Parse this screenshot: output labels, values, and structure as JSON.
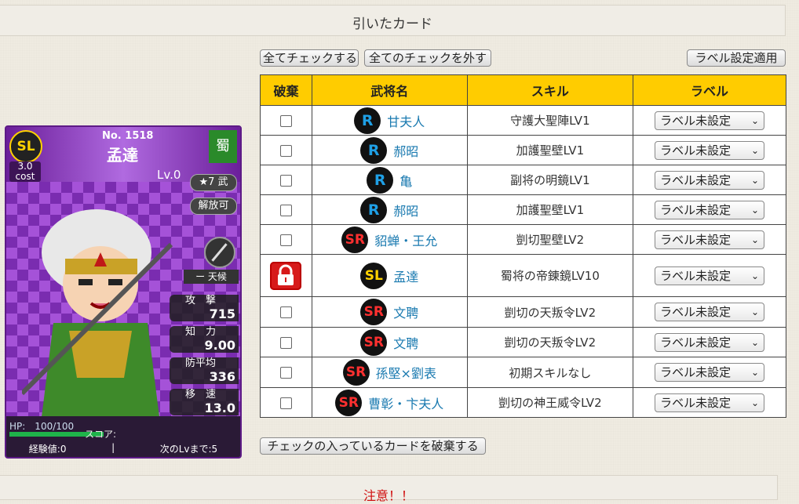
{
  "header": {
    "title": "引いたカード"
  },
  "toolbar": {
    "check_all": "全てチェックする",
    "uncheck_all": "全てのチェックを外す",
    "apply_label": "ラベル設定適用"
  },
  "table": {
    "headers": [
      "破棄",
      "武将名",
      "スキル",
      "ラベル"
    ],
    "rows": [
      {
        "rarity": "R",
        "name": "甘夫人",
        "skill": "守護大聖陣LV1",
        "label": "ラベル未設定",
        "locked": false
      },
      {
        "rarity": "R",
        "name": "郝昭",
        "skill": "加護聖壁LV1",
        "label": "ラベル未設定",
        "locked": false
      },
      {
        "rarity": "R",
        "name": "亀",
        "skill": "副将の明鏡LV1",
        "label": "ラベル未設定",
        "locked": false
      },
      {
        "rarity": "R",
        "name": "郝昭",
        "skill": "加護聖壁LV1",
        "label": "ラベル未設定",
        "locked": false
      },
      {
        "rarity": "SR",
        "name": "貂蝉・王允",
        "skill": "剴切聖壁LV2",
        "label": "ラベル未設定",
        "locked": false
      },
      {
        "rarity": "SL",
        "name": "孟達",
        "skill": "蜀将の帝錬鏡LV10",
        "label": "ラベル未設定",
        "locked": true
      },
      {
        "rarity": "SR",
        "name": "文聘",
        "skill": "剴切の天叛令LV2",
        "label": "ラベル未設定",
        "locked": false
      },
      {
        "rarity": "SR",
        "name": "文聘",
        "skill": "剴切の天叛令LV2",
        "label": "ラベル未設定",
        "locked": false
      },
      {
        "rarity": "SR",
        "name": "孫堅×劉表",
        "skill": "初期スキルなし",
        "label": "ラベル未設定",
        "locked": false
      },
      {
        "rarity": "SR",
        "name": "曹彰・卞夫人",
        "skill": "剴切の神王威令LV2",
        "label": "ラベル未設定",
        "locked": false
      }
    ]
  },
  "discard_button": "チェックの入っているカードを破棄する",
  "notice": "注意！！",
  "card": {
    "rarity": "SL",
    "cost_value": "3.0",
    "cost_label": "cost",
    "number": "No. 1518",
    "name": "孟達",
    "level": "Lv.0",
    "faction": "蜀",
    "rank": "★7 武",
    "release": "解放可",
    "weather": "ー 天候",
    "stats": [
      {
        "label": "攻　撃",
        "value": "715"
      },
      {
        "label": "知　力",
        "value": "9.00"
      },
      {
        "label": "防平均",
        "value": "336"
      },
      {
        "label": "移　速",
        "value": "13.0"
      }
    ],
    "hp": "HP:　100/100",
    "score": "スコア:",
    "exp": "経験値:0",
    "next_lv": "次のLvまで:5",
    "separator": "|"
  },
  "colors": {
    "header_yellow": "#ffcc00",
    "name_link": "#1a7ab0",
    "lock_red": "#d71a1a",
    "notice_red": "#d01010"
  }
}
